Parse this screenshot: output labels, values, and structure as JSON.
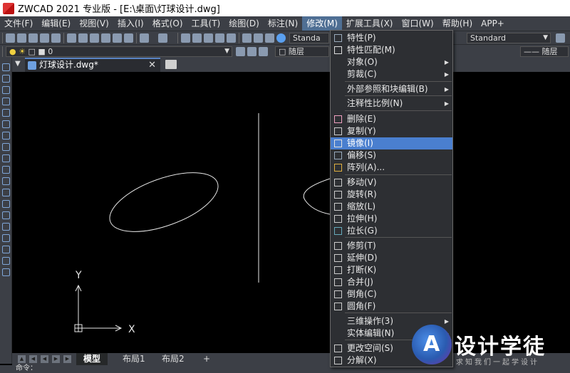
{
  "window": {
    "title": "ZWCAD 2021 专业版 - [E:\\桌面\\灯球设计.dwg]"
  },
  "menubar": {
    "items": [
      "文件(F)",
      "编辑(E)",
      "视图(V)",
      "插入(I)",
      "格式(O)",
      "工具(T)",
      "绘图(D)",
      "标注(N)",
      "修改(M)",
      "扩展工具(X)",
      "窗口(W)",
      "帮助(H)",
      "APP+"
    ],
    "active_index": 8
  },
  "toolbar": {
    "text_style": "Standa",
    "dim_style": "Standard",
    "layer": "0",
    "color": "随层",
    "linetype": "随层"
  },
  "document_tab": {
    "label": "灯球设计.dwg*",
    "close_glyph": "✕"
  },
  "layout_tabs": {
    "items": [
      "模型",
      "布局1",
      "布局2",
      "+"
    ],
    "active_index": 0
  },
  "command_line": {
    "prompt": "命令："
  },
  "canvas": {
    "ucs_x_label": "X",
    "ucs_y_label": "Y"
  },
  "modify_menu": {
    "items": [
      {
        "label": "特性(P)",
        "icon": "properties-icon",
        "submenu": false
      },
      {
        "label": "特性匹配(M)",
        "icon": "match-properties-icon",
        "submenu": false
      },
      {
        "label": "对象(O)",
        "icon": "",
        "submenu": true
      },
      {
        "label": "剪裁(C)",
        "icon": "",
        "submenu": true
      },
      {
        "label": "外部参照和块编辑(B)",
        "icon": "",
        "submenu": true
      },
      {
        "label": "注释性比例(N)",
        "icon": "",
        "submenu": true
      },
      {
        "label": "删除(E)",
        "icon": "eraser-icon",
        "submenu": false
      },
      {
        "label": "复制(Y)",
        "icon": "copy-icon",
        "submenu": false
      },
      {
        "label": "镜像(I)",
        "icon": "mirror-icon",
        "submenu": false
      },
      {
        "label": "偏移(S)",
        "icon": "offset-icon",
        "submenu": false
      },
      {
        "label": "阵列(A)...",
        "icon": "array-icon",
        "submenu": false
      },
      {
        "label": "移动(V)",
        "icon": "move-icon",
        "submenu": false
      },
      {
        "label": "旋转(R)",
        "icon": "rotate-icon",
        "submenu": false
      },
      {
        "label": "缩放(L)",
        "icon": "scale-icon",
        "submenu": false
      },
      {
        "label": "拉伸(H)",
        "icon": "stretch-icon",
        "submenu": false
      },
      {
        "label": "拉长(G)",
        "icon": "lengthen-icon",
        "submenu": false
      },
      {
        "label": "修剪(T)",
        "icon": "trim-icon",
        "submenu": false
      },
      {
        "label": "延伸(D)",
        "icon": "extend-icon",
        "submenu": false
      },
      {
        "label": "打断(K)",
        "icon": "break-icon",
        "submenu": false
      },
      {
        "label": "合并(J)",
        "icon": "join-icon",
        "submenu": false
      },
      {
        "label": "倒角(C)",
        "icon": "chamfer-icon",
        "submenu": false
      },
      {
        "label": "圆角(F)",
        "icon": "fillet-icon",
        "submenu": false
      },
      {
        "label": "三维操作(3)",
        "icon": "",
        "submenu": true
      },
      {
        "label": "实体编辑(N)",
        "icon": "",
        "submenu": true
      },
      {
        "label": "更改空间(S)",
        "icon": "change-space-icon",
        "submenu": false
      },
      {
        "label": "分解(X)",
        "icon": "explode-icon",
        "submenu": false
      }
    ],
    "highlight_index": 8
  },
  "watermark": {
    "logo_letter": "A",
    "title": "设计学徒",
    "subtitle": "求知我们一起学设计"
  },
  "colors": {
    "ui_panel": "#3c3f46",
    "highlight": "#4a7fcf",
    "canvas_bg": "#000000"
  }
}
